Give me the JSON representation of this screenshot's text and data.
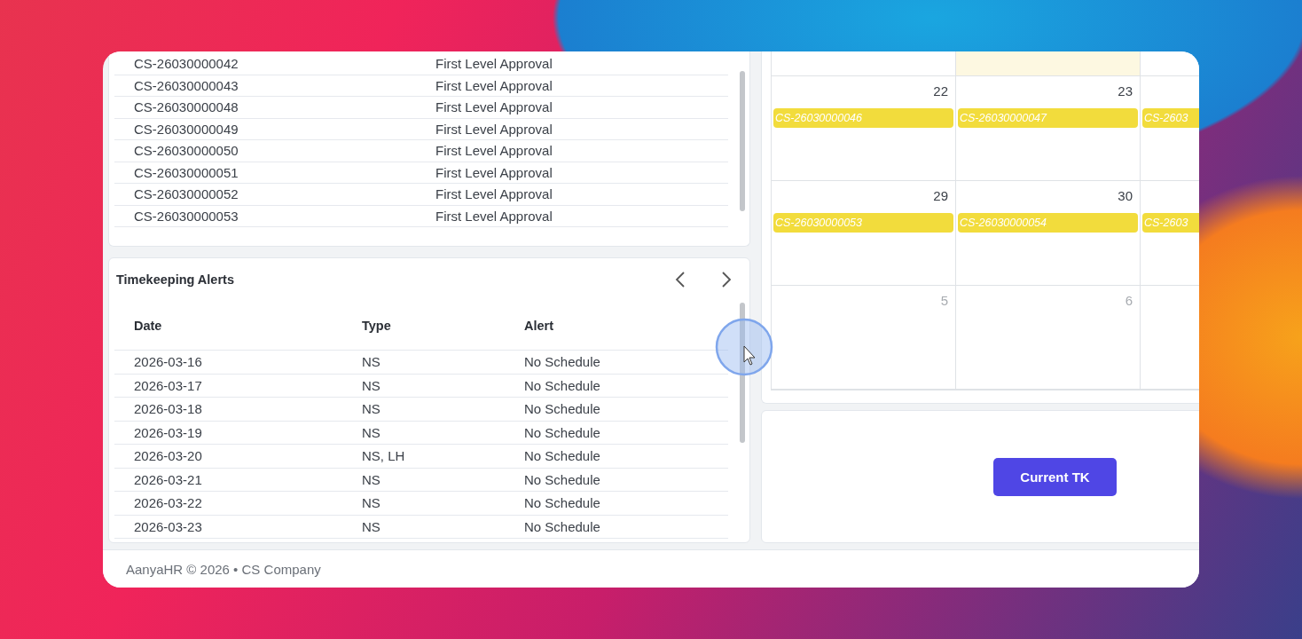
{
  "approvals": {
    "rows": [
      {
        "id": "CS-26030000042",
        "status": "First Level Approval"
      },
      {
        "id": "CS-26030000043",
        "status": "First Level Approval"
      },
      {
        "id": "CS-26030000048",
        "status": "First Level Approval"
      },
      {
        "id": "CS-26030000049",
        "status": "First Level Approval"
      },
      {
        "id": "CS-26030000050",
        "status": "First Level Approval"
      },
      {
        "id": "CS-26030000051",
        "status": "First Level Approval"
      },
      {
        "id": "CS-26030000052",
        "status": "First Level Approval"
      },
      {
        "id": "CS-26030000053",
        "status": "First Level Approval"
      }
    ]
  },
  "timekeeping_alerts": {
    "title": "Timekeeping Alerts",
    "columns": [
      "Date",
      "Type",
      "Alert"
    ],
    "rows": [
      {
        "date": "2026-03-16",
        "type": "NS",
        "alert": "No Schedule"
      },
      {
        "date": "2026-03-17",
        "type": "NS",
        "alert": "No Schedule"
      },
      {
        "date": "2026-03-18",
        "type": "NS",
        "alert": "No Schedule"
      },
      {
        "date": "2026-03-19",
        "type": "NS",
        "alert": "No Schedule"
      },
      {
        "date": "2026-03-20",
        "type": "NS, LH",
        "alert": "No Schedule"
      },
      {
        "date": "2026-03-21",
        "type": "NS",
        "alert": "No Schedule"
      },
      {
        "date": "2026-03-22",
        "type": "NS",
        "alert": "No Schedule"
      },
      {
        "date": "2026-03-23",
        "type": "NS",
        "alert": "No Schedule"
      }
    ]
  },
  "calendar": {
    "weeks": [
      {
        "days": [
          {
            "today": false
          },
          {
            "today": true
          },
          {
            "today": false
          }
        ]
      },
      {
        "days": [
          {
            "day": "22",
            "other_month": false,
            "today": false,
            "events": [
              "CS-26030000046"
            ]
          },
          {
            "day": "23",
            "other_month": false,
            "today": false,
            "events": [
              "CS-26030000047"
            ]
          },
          {
            "today": false,
            "events": [
              "CS-2603"
            ]
          }
        ]
      },
      {
        "days": [
          {
            "day": "29",
            "other_month": false,
            "today": false,
            "events": [
              "CS-26030000053"
            ]
          },
          {
            "day": "30",
            "other_month": false,
            "today": false,
            "events": [
              "CS-26030000054"
            ]
          },
          {
            "today": false,
            "events": [
              "CS-2603"
            ]
          }
        ]
      },
      {
        "days": [
          {
            "day": "5",
            "other_month": true,
            "today": false
          },
          {
            "day": "6",
            "other_month": true,
            "today": false
          },
          {
            "today": false
          }
        ]
      }
    ]
  },
  "actions": {
    "current_tk_button": {
      "label": "Current TK"
    }
  },
  "footer": {
    "text": "AanyaHR © 2026 • CS Company"
  }
}
